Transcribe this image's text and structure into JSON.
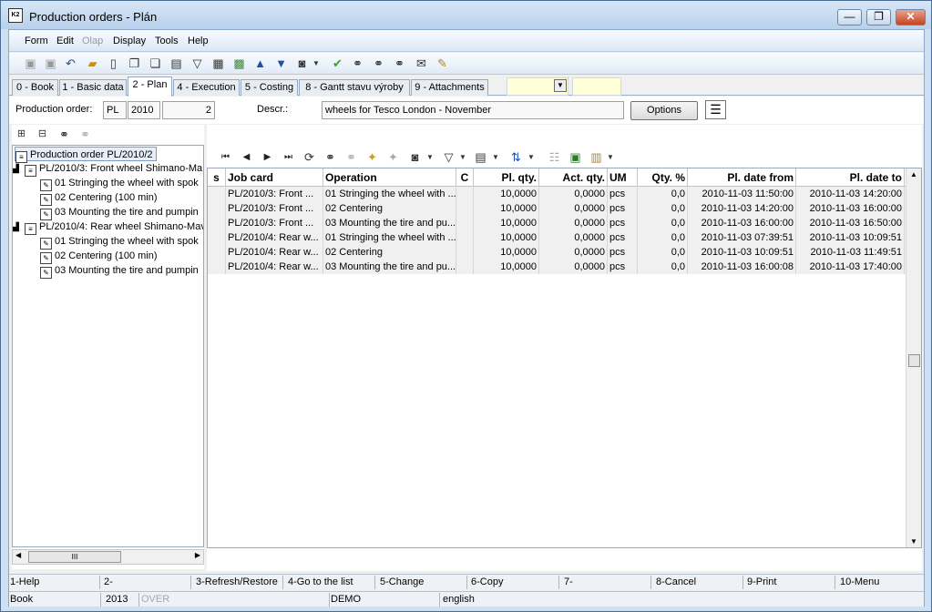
{
  "window": {
    "title": "Production orders - Plán",
    "app_icon_text": "K2",
    "minimize": "—",
    "maximize": "❐",
    "close": "✕"
  },
  "menu": [
    "Form",
    "Edit",
    "Olap",
    "Display",
    "Tools",
    "Help"
  ],
  "menu_disabled": [
    "Olap"
  ],
  "toolbar_icons": [
    "save-icon",
    "save-as-icon",
    "undo-icon",
    "open-folder-icon",
    "new-document-icon",
    "copy-icon",
    "paste-icon",
    "book-icon",
    "filter-icon",
    "filter-list-icon",
    "stack-icon",
    "arrow-up-icon",
    "arrow-down-icon",
    "camera-icon",
    "dropdown-icon",
    "check-icon",
    "binoculars-icon",
    "binoculars-next-icon",
    "binoculars-prev-icon",
    "mail-icon",
    "notes-icon"
  ],
  "tabs": [
    "0 - Book",
    "1 - Basic data",
    "2 - Plan",
    "4 - Execution",
    "5 - Costing",
    "8 - Gantt stavu výroby",
    "9 - Attachments"
  ],
  "active_tab": "2 - Plan",
  "form": {
    "production_order_label": "Production order:",
    "book": "PL",
    "year": "2010",
    "number": "2",
    "descr_label": "Descr.:",
    "descr": "wheels for Tesco London - November",
    "options_button": "Options"
  },
  "tree": {
    "root": "Production order PL/2010/2",
    "nodes": [
      {
        "label": "PL/2010/3: Front wheel Shimano-Ma",
        "level": 1
      },
      {
        "label": "01 Stringing the wheel with spok",
        "level": 2
      },
      {
        "label": "02 Centering (100 min)",
        "level": 2
      },
      {
        "label": "03 Mounting the tire and pumpin",
        "level": 2
      },
      {
        "label": "PL/2010/4: Rear wheel Shimano-Mav",
        "level": 1
      },
      {
        "label": "01 Stringing the wheel with spok",
        "level": 2
      },
      {
        "label": "02 Centering (100 min)",
        "level": 2
      },
      {
        "label": "03 Mounting the tire and pumpin",
        "level": 2
      }
    ],
    "scroll_grip": "III"
  },
  "grid": {
    "columns": [
      "s",
      "Job card",
      "Operation",
      "C",
      "Pl. qty.",
      "Act. qty.",
      "UM",
      "Qty. %",
      "Pl. date from",
      "Pl. date to"
    ],
    "rows": [
      [
        "",
        "PL/2010/3: Front ...",
        "01 Stringing the wheel with ...",
        "",
        "10,0000",
        "0,0000",
        "pcs",
        "0,0",
        "2010-11-03 11:50:00",
        "2010-11-03 14:20:00"
      ],
      [
        "",
        "PL/2010/3: Front ...",
        "02 Centering",
        "",
        "10,0000",
        "0,0000",
        "pcs",
        "0,0",
        "2010-11-03 14:20:00",
        "2010-11-03 16:00:00"
      ],
      [
        "",
        "PL/2010/3: Front ...",
        "03 Mounting the tire and pu...",
        "",
        "10,0000",
        "0,0000",
        "pcs",
        "0,0",
        "2010-11-03 16:00:00",
        "2010-11-03 16:50:00"
      ],
      [
        "",
        "PL/2010/4: Rear w...",
        "01 Stringing the wheel with ...",
        "",
        "10,0000",
        "0,0000",
        "pcs",
        "0,0",
        "2010-11-03 07:39:51",
        "2010-11-03 10:09:51"
      ],
      [
        "",
        "PL/2010/4: Rear w...",
        "02 Centering",
        "",
        "10,0000",
        "0,0000",
        "pcs",
        "0,0",
        "2010-11-03 10:09:51",
        "2010-11-03 11:49:51"
      ],
      [
        "",
        "PL/2010/4: Rear w...",
        "03 Mounting the tire and pu...",
        "",
        "10,0000",
        "0,0000",
        "pcs",
        "0,0",
        "2010-11-03 16:00:08",
        "2010-11-03 17:40:00"
      ]
    ]
  },
  "function_keys": [
    "1-Help",
    "2-",
    "3-Refresh/Restore",
    "4-Go to the list",
    "5-Change",
    "6-Copy",
    "7-",
    "8-Cancel",
    "9-Print",
    "10-Menu"
  ],
  "status": {
    "book": "Book",
    "year": "2013",
    "over": "OVER",
    "mode": "DEMO",
    "language": "english"
  }
}
